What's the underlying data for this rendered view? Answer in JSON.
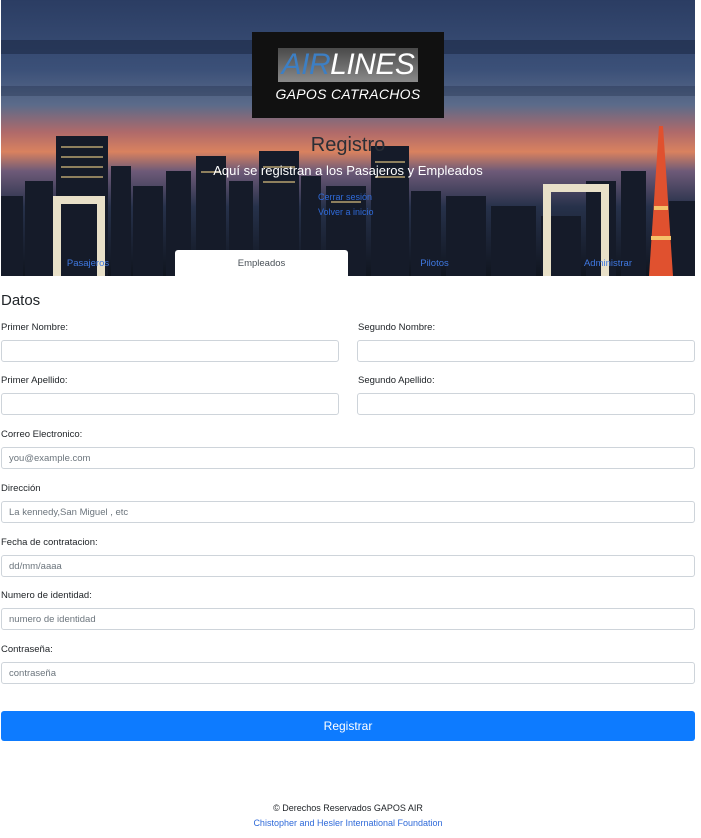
{
  "hero": {
    "logo": {
      "line1_air": "AIR",
      "line1_lines": "LINES",
      "line2": "GAPOS CATRACHOS"
    },
    "title": "Registro",
    "subtitle": "Aquí se registran a los Pasajeros y Empleados",
    "links": [
      "Cerrar sesión",
      "Volver a inicio"
    ]
  },
  "tabs": [
    {
      "label": "Pasajeros",
      "active": false
    },
    {
      "label": "Empleados",
      "active": true
    },
    {
      "label": "Pilotos",
      "active": false
    },
    {
      "label": "Administrar",
      "active": false
    }
  ],
  "form": {
    "section_title": "Datos",
    "primer_nombre": {
      "label": "Primer Nombre:",
      "value": "",
      "placeholder": ""
    },
    "segundo_nombre": {
      "label": "Segundo Nombre:",
      "value": "",
      "placeholder": ""
    },
    "primer_apellido": {
      "label": "Primer Apellido:",
      "value": "",
      "placeholder": ""
    },
    "segundo_apellido": {
      "label": "Segundo Apellido:",
      "value": "",
      "placeholder": ""
    },
    "correo": {
      "label": "Correo Electronico:",
      "value": "",
      "placeholder": "you@example.com"
    },
    "direccion": {
      "label": "Dirección",
      "value": "",
      "placeholder": "La kennedy,San Miguel , etc"
    },
    "fecha": {
      "label": "Fecha de contratacion:",
      "value": "",
      "placeholder": "dd/mm/aaaa"
    },
    "identidad": {
      "label": "Numero de identidad:",
      "value": "",
      "placeholder": "numero de identidad"
    },
    "contrasena": {
      "label": "Contraseña:",
      "value": "",
      "placeholder": "contraseña"
    },
    "submit_label": "Registrar"
  },
  "footer": {
    "copyright": "© Derechos Reservados GAPOS AIR",
    "foundation": "Chistopher and Hesler International Foundation"
  },
  "colors": {
    "primary": "#0d7bff",
    "link": "#2f6ad9",
    "border": "#ced4da"
  }
}
